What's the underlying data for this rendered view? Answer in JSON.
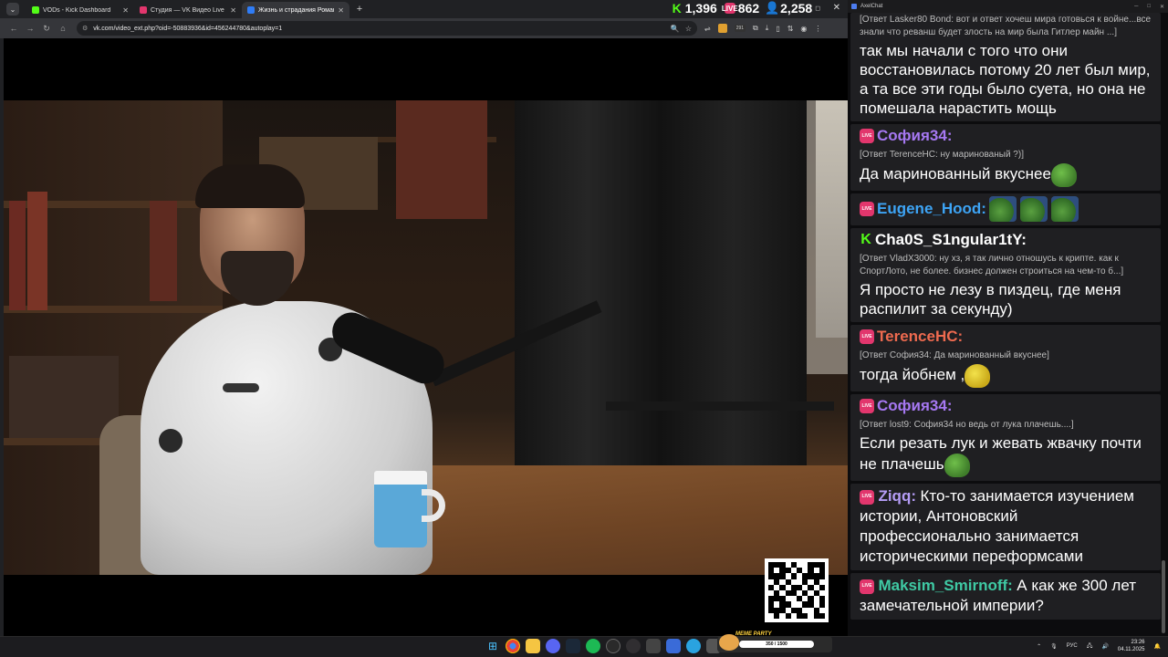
{
  "browser": {
    "tabs": [
      {
        "title": "VODs - Kick Dashboard",
        "color": "#53fc18",
        "active": false
      },
      {
        "title": "Студия — VK Видео Live",
        "color": "#e2366d",
        "active": false
      },
      {
        "title": "Жизнь и страдания Романов",
        "color": "#2f7cf6",
        "active": true
      }
    ],
    "new_tab": "+",
    "close": "✕",
    "url": "vk.com/video_ext.php?oid=-50883936&id=456244780&autoplay=1",
    "ext_badge": "291"
  },
  "stats": {
    "kick_viewers": "1,396",
    "vk_viewers": "862",
    "total_viewers": "2,258"
  },
  "chat_app": {
    "title": "AxelChat"
  },
  "chat": {
    "messages": [
      {
        "reply": "[Ответ Lasker80 Bond: вот и ответ хочеш мира готовься к войне...все знали что реванш будет злость на мир была Гитлер майн ...]",
        "body": "так мы начали с того что они восстановилась потому 20 лет был мир, а та все эти годы было суета, но она не помешала нарастить мощь"
      },
      {
        "platform": "live",
        "nick": "София34:",
        "nick_color": "#a678f2",
        "reply": "[Ответ TerenceHC: ну маринованый ?)]",
        "body": "Да маринованный вкуснее"
      },
      {
        "platform": "live",
        "nick": "Eugene_Hood:",
        "nick_color": "#3da4f5"
      },
      {
        "platform": "kick",
        "nick": "Cha0S_S1ngular1tY:",
        "nick_color": "#ffffff",
        "reply": "[Ответ VladX3000: ну хз, я так лично отношусь к крипте. как к СпортЛото, не более. бизнес должен строиться на чем-то б...]",
        "body": "Я просто не лезу в пиздец, где меня распилит за секунду)"
      },
      {
        "platform": "live",
        "nick": "TerenceHC:",
        "nick_color": "#ee6a4f",
        "reply": "[Ответ София34: Да маринованный вкуснее]",
        "body": "тогда йобнем ,"
      },
      {
        "platform": "live",
        "nick": "София34:",
        "nick_color": "#a678f2",
        "reply": "[Ответ lost9: София34 но ведь от лука плачешь....]",
        "body": "Если резать лук и жевать жвачку почти не плачешь"
      },
      {
        "platform": "live",
        "nick": "Ziqq:",
        "nick_color": "#b49cf5",
        "body": "Кто-то занимается изучением истории, Антоновский профессионально занимается историческими переформсами"
      },
      {
        "platform": "live",
        "nick": "Maksim_Smirnoff:",
        "nick_color": "#3fcaa4",
        "body": "А как же 300 лет замечательной империи?"
      }
    ]
  },
  "platform_badges": {
    "live": "LIVE",
    "kick": "K"
  },
  "widget": {
    "title": "MEME PARTY",
    "progress": "350 / 1500"
  },
  "taskbar": {
    "lang": "РУС",
    "time": "23:26",
    "date": "04.11.2025"
  }
}
